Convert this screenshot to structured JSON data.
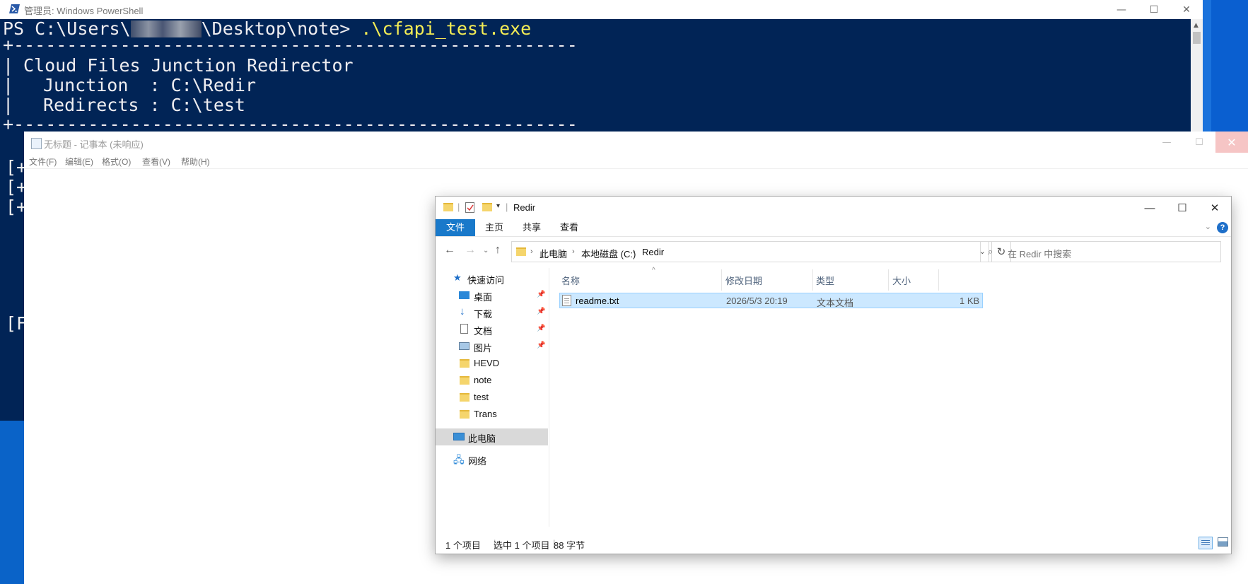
{
  "powershell": {
    "title": "管理员: Windows PowerShell",
    "prompt_prefix": "PS C:\\Users\\",
    "prompt_suffix": "\\Desktop\\note> ",
    "command": ".\\cfapi_test.exe",
    "rule_line": "+-----------------------------------------------------",
    "banner_title": "Cloud Files Junction Redirector",
    "junction_line": "Junction  : C:\\Redir",
    "redirects_line": "Redirects : C:\\test",
    "left_bar": "|",
    "minimize": "—",
    "maximize": "☐",
    "close": "✕"
  },
  "background_console": {
    "lines": [
      "[+",
      "[+",
      "[+",
      "[F"
    ]
  },
  "notepad": {
    "title": "无标题 - 记事本 (未响应)",
    "menus": [
      "文件(F)",
      "编辑(E)",
      "格式(O)",
      "查看(V)",
      "帮助(H)"
    ],
    "close": "✕"
  },
  "explorer": {
    "title": "Redir",
    "ribbon_tabs": [
      "文件",
      "主页",
      "共享",
      "查看"
    ],
    "help": "?",
    "breadcrumb": [
      "此电脑",
      "本地磁盘 (C:)",
      "Redir"
    ],
    "search_placeholder": "在 Redir 中搜索",
    "nav": {
      "quick_access": "快速访问",
      "pinned": [
        {
          "label": "桌面",
          "icon": "desktop-icon"
        },
        {
          "label": "下载",
          "icon": "download-icon"
        },
        {
          "label": "文档",
          "icon": "document-icon"
        },
        {
          "label": "图片",
          "icon": "pictures-icon"
        }
      ],
      "folders": [
        "HEVD",
        "note",
        "test",
        "Trans"
      ],
      "this_pc": "此电脑",
      "network": "网络"
    },
    "columns": [
      "名称",
      "修改日期",
      "类型",
      "大小"
    ],
    "files": [
      {
        "name": "readme.txt",
        "modified": "2026/5/3 20:19",
        "type": "文本文档",
        "size": "1 KB"
      }
    ],
    "status": {
      "item_count": "1 个项目",
      "selected": "选中 1 个项目",
      "size": "88 字节"
    }
  },
  "colors": {
    "powershell_bg": "#012456",
    "powershell_command": "#f4ed55",
    "desktop_blue": "#0a63c8",
    "ribbon_file_tab": "#1979ca",
    "selection_bg": "#cce8ff"
  }
}
